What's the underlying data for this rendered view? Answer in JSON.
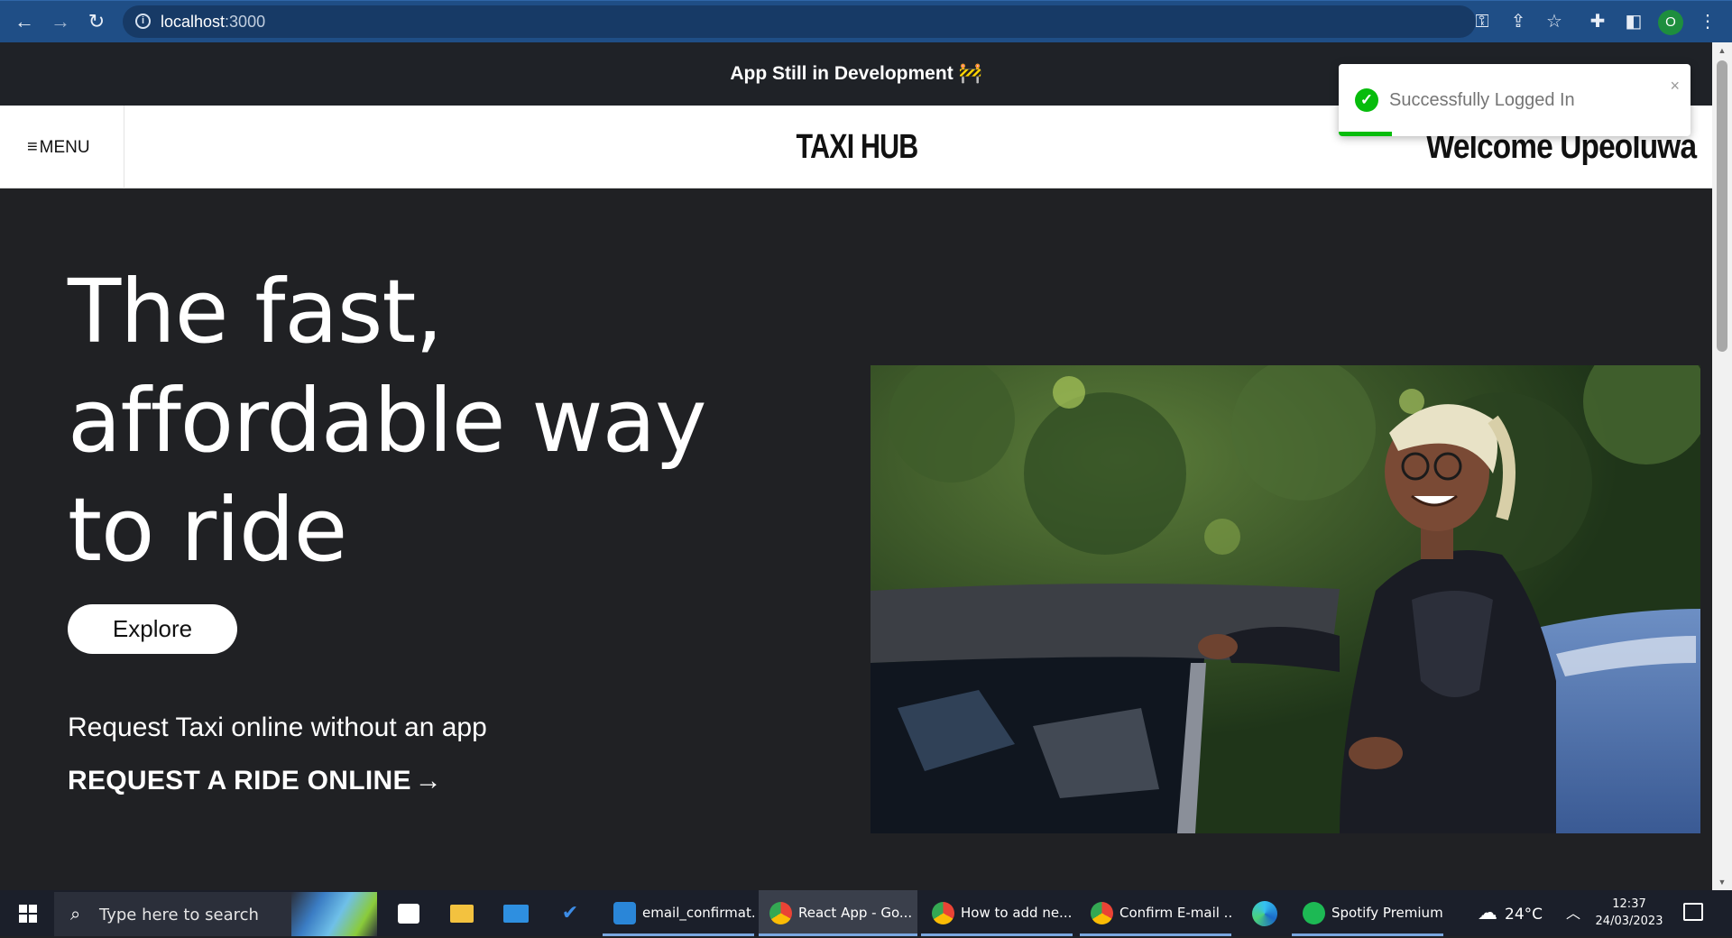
{
  "browser": {
    "url_host": "localhost",
    "url_port": ":3000",
    "profile_initial": "O"
  },
  "banner": {
    "text": "App Still in Development 🚧"
  },
  "header": {
    "menu_label": "MENU",
    "brand": "TAXI HUB",
    "welcome": "Welcome Upeoluwa"
  },
  "hero": {
    "headline_line1": "The fast,",
    "headline_line2": "affordable way",
    "headline_line3": "to ride",
    "explore_label": "Explore",
    "subtitle": "Request Taxi online without an app",
    "request_label": "REQUEST A RIDE ONLINE",
    "request_arrow": "→"
  },
  "toast": {
    "message": "Successfully Logged In",
    "close": "×",
    "progress_fraction": 0.15,
    "accent": "#07bc0c"
  },
  "taskbar": {
    "search_placeholder": "Type here to search",
    "apps": [
      {
        "label": "email_confirmat..."
      },
      {
        "label": "React App - Go..."
      },
      {
        "label": "How to add ne..."
      },
      {
        "label": "Confirm E-mail ..."
      },
      {
        "label": "Spotify Premium"
      }
    ],
    "weather": "24°C",
    "time": "12:37",
    "date": "24/03/2023"
  }
}
